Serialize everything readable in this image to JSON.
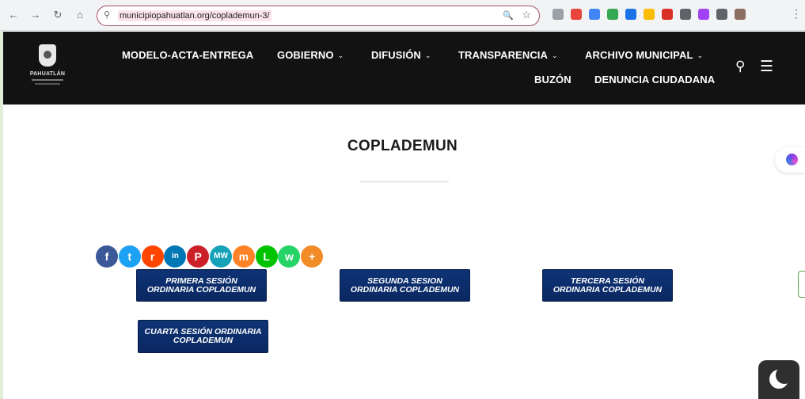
{
  "browser": {
    "back_glyph": "←",
    "forward_glyph": "→",
    "reload_glyph": "↻",
    "home_glyph": "⌂",
    "site_info_glyph": "⚲",
    "url": "municipiopahuatlan.org/coplademun-3/",
    "zoom_glyph": "🔍",
    "star_glyph": "☆",
    "menu_glyph": "⋮",
    "extension_colors": [
      "#9aa0a6",
      "#e8453c",
      "#4285f4",
      "#34a853",
      "#1a73e8",
      "#fbbc04",
      "#d93025",
      "#5f6368",
      "#a142f4",
      "#5f6368",
      "#8d6e63"
    ]
  },
  "header": {
    "logo_text": "PAHUATLÁN",
    "nav": [
      {
        "label": "MODELO-ACTA-ENTREGA",
        "has_dropdown": false
      },
      {
        "label": "GOBIERNO",
        "has_dropdown": true
      },
      {
        "label": "DIFUSIÓN",
        "has_dropdown": true
      },
      {
        "label": "TRANSPARENCIA",
        "has_dropdown": true
      },
      {
        "label": "ARCHIVO MUNICIPAL",
        "has_dropdown": true
      },
      {
        "label": "BUZÓN",
        "has_dropdown": false
      },
      {
        "label": "DENUNCIA CIUDADANA",
        "has_dropdown": false
      }
    ],
    "chevron_glyph": "⌄",
    "search_glyph": "⚲",
    "hamburger_glyph": "☰"
  },
  "page": {
    "title": "COPLADEMUN"
  },
  "share": [
    {
      "icon": "facebook-icon",
      "glyph": "f",
      "color": "#3b5998"
    },
    {
      "icon": "twitter-icon",
      "glyph": "t",
      "color": "#1da1f2"
    },
    {
      "icon": "reddit-icon",
      "glyph": "r",
      "color": "#ff4500"
    },
    {
      "icon": "linkedin-icon",
      "glyph": "in",
      "color": "#0077b5"
    },
    {
      "icon": "pinterest-icon",
      "glyph": "P",
      "color": "#cb2027"
    },
    {
      "icon": "mewe-icon",
      "glyph": "MW",
      "color": "#17a2b8"
    },
    {
      "icon": "mix-icon",
      "glyph": "m",
      "color": "#ff8226"
    },
    {
      "icon": "line-icon",
      "glyph": "L",
      "color": "#00c300"
    },
    {
      "icon": "whatsapp-icon",
      "glyph": "w",
      "color": "#25d366"
    },
    {
      "icon": "more-icon",
      "glyph": "+",
      "color": "#f28c28"
    }
  ],
  "sessions": [
    {
      "line1": "PRIMERA SESIÓN",
      "line2": "ORDINARIA COPLADEMUN"
    },
    {
      "line1": "SEGUNDA SESION",
      "line2": "ORDINARIA COPLADEMUN"
    },
    {
      "line1": "TERCERA SESIÓN",
      "line2": "ORDINARIA COPLADEMUN"
    },
    {
      "line1": "CUARTA SESIÓN ORDINARIA",
      "line2": "COPLADEMUN"
    }
  ],
  "colors": {
    "header_bg": "#121212",
    "button_bg": "#0e3375",
    "omnibox_border": "#a6506a"
  }
}
